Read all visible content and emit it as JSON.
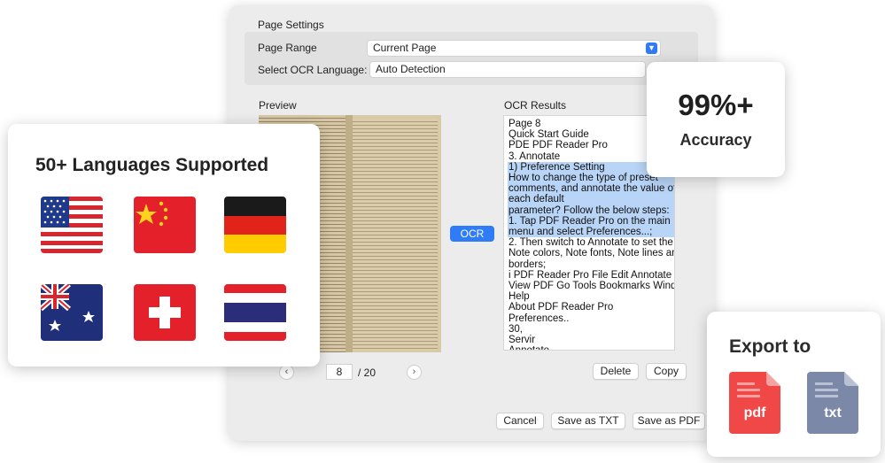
{
  "dialog": {
    "title": "Page Settings",
    "page_range_label": "Page Range",
    "page_range_value": "Current Page",
    "ocr_language_label": "Select OCR Language:",
    "ocr_language_value": "Auto Detection",
    "preview_label": "Preview",
    "results_label": "OCR Results",
    "ocr_button": "OCR",
    "current_page": "8",
    "total_pages": "/ 20",
    "delete_button": "Delete",
    "copy_button": "Copy",
    "cancel_button": "Cancel",
    "save_txt_button": "Save as TXT",
    "save_pdf_button": "Save as PDF"
  },
  "ocr_results": [
    {
      "text": "Page 8",
      "highlighted": false
    },
    {
      "text": "Quick Start Guide",
      "highlighted": false
    },
    {
      "text": "PDE PDF Reader Pro",
      "highlighted": false
    },
    {
      "text": "3. Annotate",
      "highlighted": false
    },
    {
      "text": "1) Preference Setting",
      "highlighted": true
    },
    {
      "text": "How to change the type of preset",
      "highlighted": true
    },
    {
      "text": "comments, and annotate the value of",
      "highlighted": true
    },
    {
      "text": "each default",
      "highlighted": true
    },
    {
      "text": "parameter? Follow the below steps:",
      "highlighted": true
    },
    {
      "text": "1. Tap PDF Reader Pro on the main",
      "highlighted": true
    },
    {
      "text": "menu and select Preferences...;",
      "highlighted": true
    },
    {
      "text": "2. Then switch to Annotate to set the",
      "highlighted": false
    },
    {
      "text": "Note colors, Note fonts, Note lines and",
      "highlighted": false
    },
    {
      "text": "borders;",
      "highlighted": false
    },
    {
      "text": "i PDF Reader Pro File Edit Annotate",
      "highlighted": false
    },
    {
      "text": "View PDF Go Tools Bookmarks Window",
      "highlighted": false
    },
    {
      "text": "Help",
      "highlighted": false
    },
    {
      "text": "About PDF Reader Pro",
      "highlighted": false
    },
    {
      "text": "Preferences..",
      "highlighted": false
    },
    {
      "text": "30,",
      "highlighted": false
    },
    {
      "text": "Servir",
      "highlighted": false
    },
    {
      "text": "Annotate",
      "highlighted": false
    }
  ],
  "languages_card": {
    "title": "50+ Languages Supported",
    "flags": [
      "usa-flag",
      "china-flag",
      "germany-flag",
      "australia-flag",
      "switzerland-flag",
      "thailand-flag"
    ]
  },
  "accuracy_card": {
    "value": "99%+",
    "label": "Accuracy"
  },
  "export_card": {
    "title": "Export to",
    "pdf_label": "pdf",
    "txt_label": "txt"
  },
  "colors": {
    "accent": "#2f7cf6",
    "highlight": "#b8d4f7",
    "pdf_red": "#f04747",
    "txt_slate": "#7b88a8"
  }
}
